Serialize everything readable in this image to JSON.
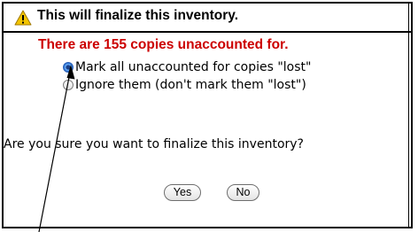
{
  "dialog": {
    "title": "This will finalize this inventory.",
    "warning": "There are 155 copies unaccounted for.",
    "options": [
      {
        "label": "Mark all unaccounted for copies \"lost\"",
        "selected": true
      },
      {
        "label": "Ignore them (don't mark them \"lost\")",
        "selected": false
      }
    ],
    "question": "Are you sure you want to finalize this inventory?",
    "yes_label": "Yes",
    "no_label": "No"
  },
  "icons": {
    "warning": "warning-triangle-icon",
    "annotation": "pointer-arrow"
  },
  "colors": {
    "warning_text": "#cc0000",
    "icon_fill": "#f3c500",
    "radio_selected": "#2d6fcf"
  }
}
